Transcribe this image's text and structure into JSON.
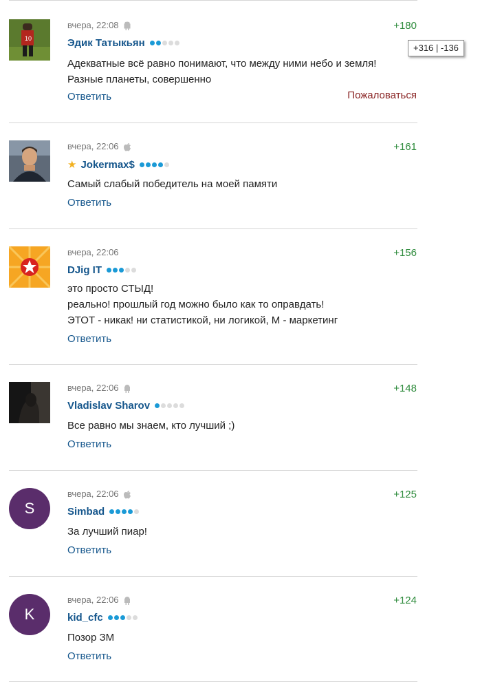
{
  "tooltip": {
    "votes": "+316 | -136"
  },
  "comments": [
    {
      "time": "вчера, 22:08",
      "platform_icon": "android-icon",
      "author": "Эдик Татыкьян",
      "star": false,
      "level": 2,
      "text": "Адекватные всё равно понимают, что между ними небо и земля!\nРазные планеты, совершенно",
      "score": "+180",
      "reply_label": "Ответить",
      "complain_label": "Пожаловаться"
    },
    {
      "time": "вчера, 22:06",
      "platform_icon": "apple-icon",
      "author": "Jokermax$",
      "star": true,
      "level": 4,
      "text": "Самый слабый победитель на моей памяти",
      "score": "+161",
      "reply_label": "Ответить"
    },
    {
      "time": "вчера, 22:06",
      "platform_icon": "none",
      "author": "DJig IT",
      "star": false,
      "level": 3,
      "text": "это просто СТЫД!\nреально! прошлый год можно было как то оправдать!\nЭТОТ - никак! ни статистикой, ни логикой, М - маркетинг",
      "score": "+156",
      "reply_label": "Ответить"
    },
    {
      "time": "вчера, 22:06",
      "platform_icon": "android-icon",
      "author": "Vladislav Sharov",
      "star": false,
      "level": 1,
      "text": "Все равно мы знаем, кто лучший ;)",
      "score": "+148",
      "reply_label": "Ответить"
    },
    {
      "time": "вчера, 22:06",
      "platform_icon": "apple-icon",
      "author": "Simbad",
      "star": false,
      "level": 4,
      "text": "За лучший пиар!",
      "score": "+125",
      "reply_label": "Ответить",
      "avatar_letter": "S"
    },
    {
      "time": "вчера, 22:06",
      "platform_icon": "android-icon",
      "author": "kid_cfc",
      "star": false,
      "level": 3,
      "text": "Позор ЗМ",
      "score": "+124",
      "reply_label": "Ответить",
      "avatar_letter": "K"
    }
  ]
}
